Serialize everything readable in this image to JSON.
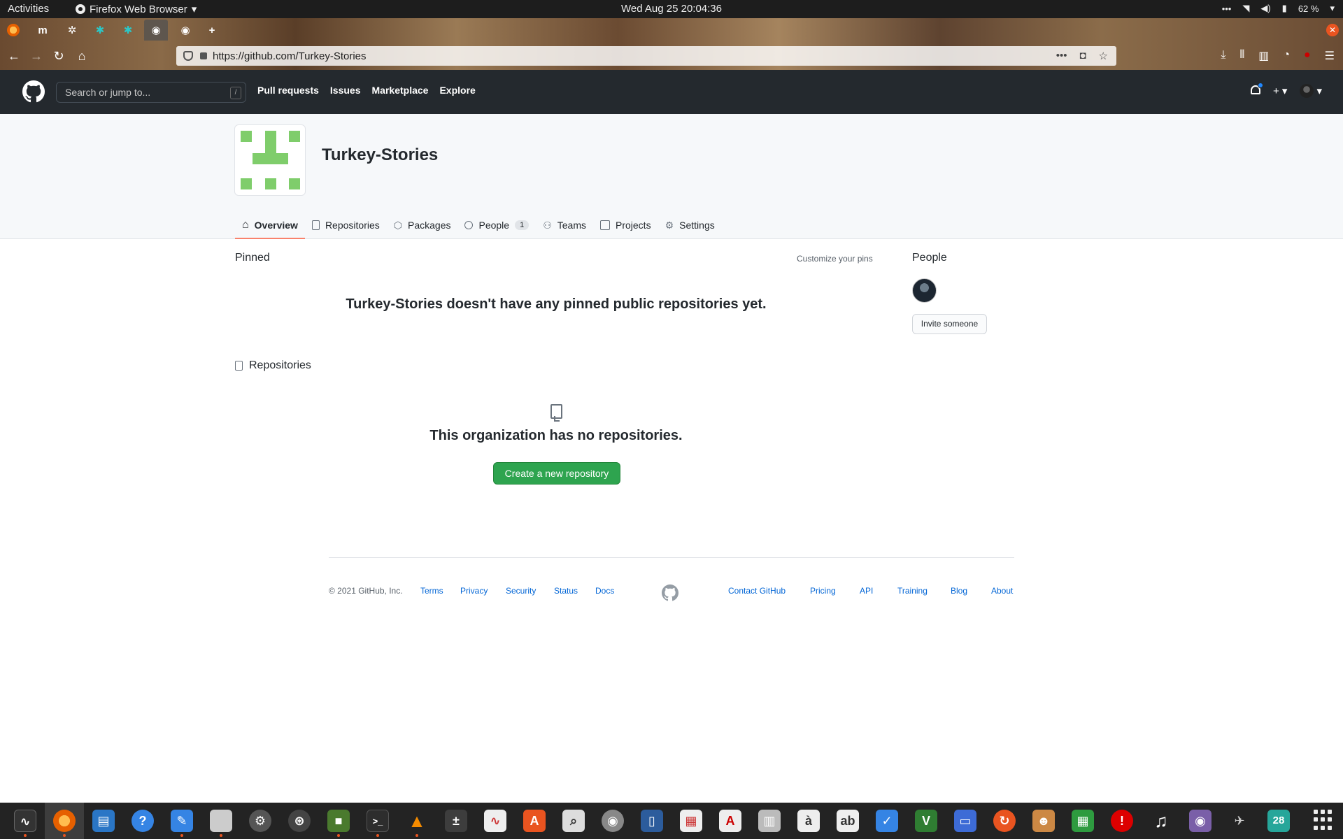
{
  "system": {
    "activities": "Activities",
    "app_name": "Firefox Web Browser",
    "clock": "Wed Aug 25  20:04:36",
    "battery": "62 %"
  },
  "browser": {
    "url": "https://github.com/Turkey-Stories",
    "tabs": [
      "firefox-icon",
      "medium-icon",
      "gear-icon",
      "tealbird-icon",
      "tealbird-icon",
      "github-icon",
      "github-icon"
    ],
    "new_tab": "+",
    "medium_letter": "m"
  },
  "github": {
    "search_placeholder": "Search or jump to...",
    "search_shortcut": "/",
    "nav": [
      "Pull requests",
      "Issues",
      "Marketplace",
      "Explore"
    ],
    "plus": "+"
  },
  "org": {
    "name": "Turkey-Stories",
    "avatar_colors": {
      "pixel": "#7fcd6b"
    },
    "tabs": [
      {
        "label": "Overview",
        "icon": "home-icon",
        "active": true
      },
      {
        "label": "Repositories",
        "icon": "repo-icon"
      },
      {
        "label": "Packages",
        "icon": "package-icon"
      },
      {
        "label": "People",
        "icon": "person-icon",
        "count": "1"
      },
      {
        "label": "Teams",
        "icon": "people-icon"
      },
      {
        "label": "Projects",
        "icon": "project-icon"
      },
      {
        "label": "Settings",
        "icon": "gear-icon"
      }
    ]
  },
  "main": {
    "pinned_label": "Pinned",
    "customize": "Customize your pins",
    "pinned_empty": "Turkey-Stories doesn't have any pinned public repositories yet.",
    "repos_label": "Repositories",
    "repos_empty": "This organization has no repositories.",
    "create_button": "Create a new repository",
    "people_label": "People",
    "invite_button": "Invite someone"
  },
  "footer": {
    "copyright": "© 2021 GitHub, Inc.",
    "left_links": [
      "Terms",
      "Privacy",
      "Security",
      "Status",
      "Docs"
    ],
    "right_links": [
      "Contact GitHub",
      "Pricing",
      "API",
      "Training",
      "Blog",
      "About"
    ]
  },
  "dock": {
    "apps": [
      "system-monitor-icon",
      "firefox-icon",
      "writer-icon",
      "help-icon",
      "text-editor-icon",
      "files-icon",
      "settings-icon",
      "software-icon",
      "minecraft-icon",
      "terminal-icon",
      "vlc-icon",
      "calculator-icon",
      "chart-icon",
      "app-store-icon",
      "image-viewer-icon",
      "rhythm-icon",
      "dictionary-icon",
      "document-icon",
      "pdf-icon",
      "archive-icon",
      "char-map-icon",
      "ab-icon",
      "todo-icon",
      "vim-icon",
      "screen-icon",
      "update-icon",
      "game-icon",
      "spreadsheet-icon",
      "alert-icon",
      "music-icon",
      "camera-icon",
      "jet-icon",
      "calendar-icon"
    ],
    "calendar_day": "28",
    "colors": {
      "accent": "#e95420",
      "bg": "#232323"
    }
  }
}
